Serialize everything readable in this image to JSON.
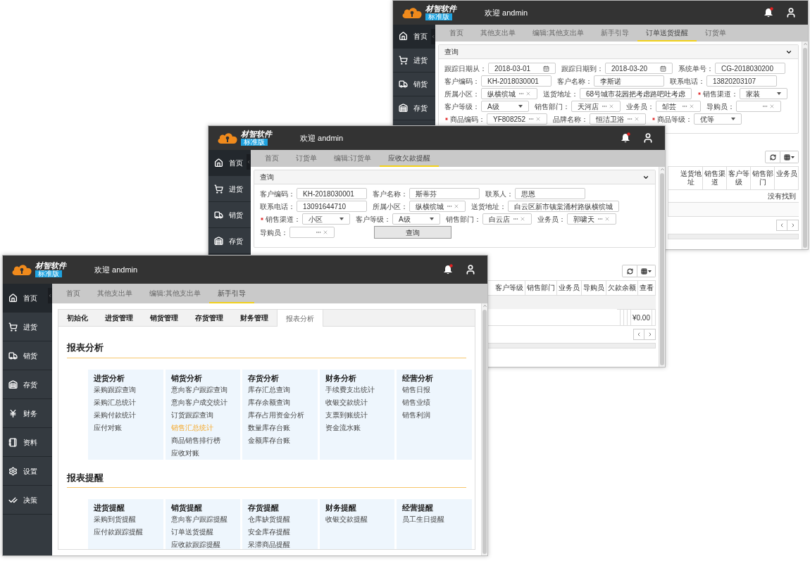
{
  "windows": [
    {
      "kind": "query_table",
      "header": {
        "logo": "材智软件",
        "edition": "标准版",
        "welcome": "欢迎 andmin"
      },
      "sidebar": [
        {
          "label": "首页",
          "selected": true
        },
        {
          "label": "进货",
          "selected": false
        },
        {
          "label": "销货",
          "selected": false
        },
        {
          "label": "存货",
          "selected": false
        }
      ],
      "tabs": [
        {
          "label": "首页",
          "selected": false
        },
        {
          "label": "其他支出单",
          "selected": false
        },
        {
          "label": "编辑:其他支出单",
          "selected": false
        },
        {
          "label": "新手引导",
          "selected": false
        },
        {
          "label": "订单送货提醒",
          "selected": true
        },
        {
          "label": "订货单",
          "selected": false
        }
      ],
      "query": {
        "title": "查询",
        "rows": [
          [
            {
              "label": "跟踪日期从：",
              "kind": "date",
              "value": "2018-03-01",
              "required": false
            },
            {
              "label": "跟踪日期到：",
              "kind": "date",
              "value": "2018-03-20",
              "required": false
            },
            {
              "label": "系统单号：",
              "kind": "text",
              "value": "CG-2018030200",
              "required": false
            }
          ],
          [
            {
              "label": "客户编码：",
              "kind": "text",
              "value": "KH-2018030001",
              "required": false
            },
            {
              "label": "客户名称：",
              "kind": "text",
              "value": "李斯诺",
              "required": false
            },
            {
              "label": "联系电话：",
              "kind": "text",
              "value": "13820203107",
              "required": false
            }
          ],
          [
            {
              "label": "所属小区：",
              "kind": "picker",
              "value": "纵横缤城",
              "required": false
            },
            {
              "label": "送货地址：",
              "kind": "text",
              "value": "68号城市花园把考虑路吧吐考虑",
              "required": false
            },
            {
              "label": "销售渠道：",
              "kind": "select",
              "value": "家装",
              "required": true
            }
          ],
          [
            {
              "label": "客户等级：",
              "kind": "select",
              "value": "A级",
              "required": false
            },
            {
              "label": "销售部门：",
              "kind": "picker",
              "value": "天河店",
              "required": false
            },
            {
              "label": "业务员：",
              "kind": "picker",
              "value": "邹芸",
              "required": false
            },
            {
              "label": "导购员：",
              "kind": "picker",
              "required": false
            }
          ],
          [
            {
              "label": "商品编码：",
              "kind": "picker",
              "value": "YF808252",
              "required": true
            },
            {
              "label": "品牌名称：",
              "kind": "picker",
              "value": "恒洁卫浴",
              "required": false
            },
            {
              "label": "商品等级：",
              "kind": "select",
              "value": "优等",
              "required": true
            }
          ]
        ]
      },
      "table": {
        "columns": [
          "送货地址",
          "销售渠道",
          "客户等级",
          "销售部门",
          "业务员"
        ],
        "empty_text": "没有找到"
      }
    },
    {
      "kind": "query_table",
      "header": {
        "logo": "材智软件",
        "edition": "标准版",
        "welcome": "欢迎 andmin"
      },
      "sidebar": [
        {
          "label": "首页",
          "selected": true
        },
        {
          "label": "进货",
          "selected": false
        },
        {
          "label": "销货",
          "selected": false
        },
        {
          "label": "存货",
          "selected": false
        }
      ],
      "tabs": [
        {
          "label": "首页",
          "selected": false
        },
        {
          "label": "订货单",
          "selected": false
        },
        {
          "label": "编辑:订货单",
          "selected": false
        },
        {
          "label": "应收欠款提醒",
          "selected": true
        }
      ],
      "query": {
        "title": "查询",
        "button": "查询",
        "rows": [
          [
            {
              "label": "客户编码：",
              "kind": "text",
              "value": "KH-2018030001",
              "required": false
            },
            {
              "label": "客户名称：",
              "kind": "text",
              "value": "斯蒂芬",
              "required": false
            },
            {
              "label": "联系人：",
              "kind": "text",
              "value": "思恩",
              "required": false
            }
          ],
          [
            {
              "label": "联系电话：",
              "kind": "text",
              "value": "13091644710",
              "required": false
            },
            {
              "label": "所属小区：",
              "kind": "picker",
              "value": "纵横缤城",
              "required": false
            },
            {
              "label": "送货地址：",
              "kind": "text",
              "value": "白云区新市镇棠涌村路纵横缤城",
              "required": false
            }
          ],
          [
            {
              "label": "销售渠道：",
              "kind": "select",
              "value": "小区",
              "required": true
            },
            {
              "label": "客户等级：",
              "kind": "select",
              "value": "A级",
              "required": false
            },
            {
              "label": "销售部门：",
              "kind": "picker",
              "value": "白云店",
              "required": false
            },
            {
              "label": "业务员：",
              "kind": "picker",
              "value": "郭啸天",
              "required": false
            }
          ],
          [
            {
              "label": "导购员：",
              "kind": "picker",
              "required": false
            }
          ]
        ]
      },
      "table": {
        "columns": [
          "客户等级",
          "销售部门",
          "业务员",
          "导购员",
          "欠款余额",
          "查看"
        ],
        "total_amount": "¥0.00"
      }
    },
    {
      "kind": "report_center",
      "header": {
        "logo": "材智软件",
        "edition": "标准版",
        "welcome": "欢迎 andmin"
      },
      "sidebar": [
        {
          "label": "首页",
          "selected": true
        },
        {
          "label": "进货",
          "selected": false
        },
        {
          "label": "销货",
          "selected": false
        },
        {
          "label": "存货",
          "selected": false
        },
        {
          "label": "财务",
          "selected": false
        },
        {
          "label": "资料",
          "selected": false
        },
        {
          "label": "设置",
          "selected": false
        },
        {
          "label": "决策",
          "selected": false
        }
      ],
      "tabs": [
        {
          "label": "首页",
          "selected": false
        },
        {
          "label": "其他支出单",
          "selected": false
        },
        {
          "label": "编辑:其他支出单",
          "selected": false
        },
        {
          "label": "新手引导",
          "selected": true
        }
      ],
      "report_tabs": [
        {
          "label": "初始化",
          "selected": false
        },
        {
          "label": "进货管理",
          "selected": false
        },
        {
          "label": "销货管理",
          "selected": false
        },
        {
          "label": "存货管理",
          "selected": false
        },
        {
          "label": "财务管理",
          "selected": false
        },
        {
          "label": "报表分析",
          "selected": true
        }
      ],
      "sections": [
        {
          "title": "报表分析",
          "groups": [
            {
              "title": "进货分析",
              "links": [
                {
                  "label": "采购跟踪查询",
                  "selected": false
                },
                {
                  "label": "采购汇总统计",
                  "selected": false
                },
                {
                  "label": "采购付款统计",
                  "selected": false
                },
                {
                  "label": "应付对账",
                  "selected": false
                }
              ]
            },
            {
              "title": "销货分析",
              "links": [
                {
                  "label": "意向客户跟踪查询",
                  "selected": false
                },
                {
                  "label": "意向客户成交统计",
                  "selected": false
                },
                {
                  "label": "订货跟踪查询",
                  "selected": false
                },
                {
                  "label": "销售汇总统计",
                  "selected": true
                },
                {
                  "label": "商品销售排行榜",
                  "selected": false
                },
                {
                  "label": "应收对账",
                  "selected": false
                }
              ]
            },
            {
              "title": "存货分析",
              "links": [
                {
                  "label": "库存汇总查询",
                  "selected": false
                },
                {
                  "label": "库存余额查询",
                  "selected": false
                },
                {
                  "label": "库存占用资金分析",
                  "selected": false
                },
                {
                  "label": "数量库存台账",
                  "selected": false
                },
                {
                  "label": "金额库存台账",
                  "selected": false
                }
              ]
            },
            {
              "title": "财务分析",
              "links": [
                {
                  "label": "手续费支出统计",
                  "selected": false
                },
                {
                  "label": "收银交款统计",
                  "selected": false
                },
                {
                  "label": "支票到账统计",
                  "selected": false
                },
                {
                  "label": "资金流水账",
                  "selected": false
                }
              ]
            },
            {
              "title": "经营分析",
              "links": [
                {
                  "label": "销售日报",
                  "selected": false
                },
                {
                  "label": "销售业绩",
                  "selected": false
                },
                {
                  "label": "销售利润",
                  "selected": false
                }
              ]
            }
          ]
        },
        {
          "title": "报表提醒",
          "groups": [
            {
              "title": "进货提醒",
              "links": [
                {
                  "label": "采购到货提醒",
                  "selected": false
                },
                {
                  "label": "应付款跟踪提醒",
                  "selected": false
                }
              ]
            },
            {
              "title": "销货提醒",
              "links": [
                {
                  "label": "意向客户跟踪提醒",
                  "selected": false
                },
                {
                  "label": "订单送货提醒",
                  "selected": false
                },
                {
                  "label": "应收款跟踪提醒",
                  "selected": false
                }
              ]
            },
            {
              "title": "存货提醒",
              "links": [
                {
                  "label": "仓库缺货提醒",
                  "selected": false
                },
                {
                  "label": "安全库存提醒",
                  "selected": false
                },
                {
                  "label": "呆滞商品提醒",
                  "selected": false
                }
              ]
            },
            {
              "title": "财务提醒",
              "links": [
                {
                  "label": "收银交款提醒",
                  "selected": false
                }
              ]
            },
            {
              "title": "经营提醒",
              "links": [
                {
                  "label": "员工生日提醒",
                  "selected": false
                }
              ]
            }
          ]
        }
      ]
    }
  ]
}
